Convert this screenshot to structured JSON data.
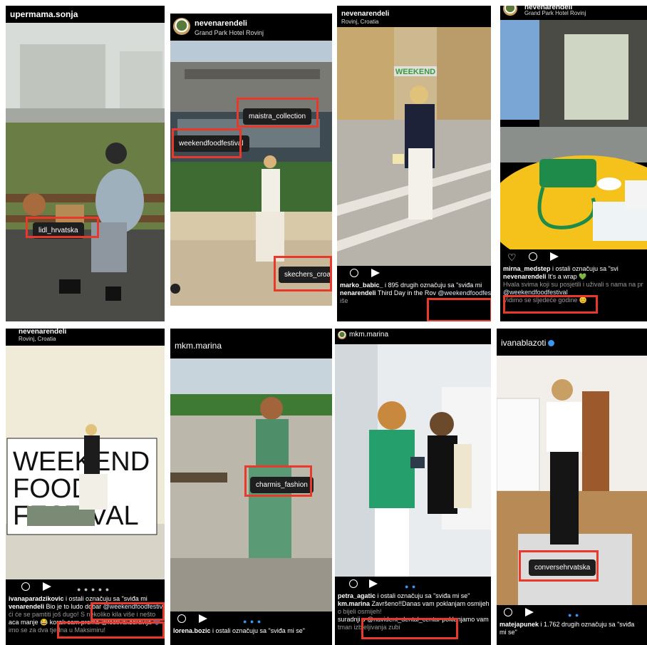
{
  "colors": {
    "highlight": "#e8392b",
    "instagram_black": "#000000",
    "link_blue": "#3897f0"
  },
  "icons": [
    "heart-icon",
    "comment-icon",
    "send-icon",
    "location-icon",
    "verified-icon",
    "carousel-dots-icon"
  ],
  "posts": [
    {
      "username": "upermama.sonja",
      "tag": "lidl_hrvatska"
    },
    {
      "username": "nevenarendeli",
      "location": "Grand Park Hotel Rovinj",
      "tags": [
        "maistra_collection",
        "weekendfoodfestival",
        "skechers_croatia"
      ]
    },
    {
      "username": "nevenarendeli",
      "location": "Rovinj, Croatia",
      "likes_user": "marko_babic_",
      "likes_text": " i 895 drugih označuju sa \"sviđa mi",
      "caption_user": "nenarendeli",
      "caption": "Third Day in the Rov",
      "caption_tag": "@weekendfoodfestiv",
      "caption_more": "iše"
    },
    {
      "username": "nevenarendeli",
      "location": "Grand Park Hotel Rovinj",
      "likes_user": "mirna_medstep",
      "likes_text": " i ostali označuju sa \"svi",
      "caption_user": "nevenarendeli",
      "caption": " It's a wrap 💚",
      "caption2": "Hvala svima koji su posjetili i uživali s nama na pr",
      "caption_tag": "@weekendfoodfestival",
      "caption3": "Vidimo se sljedeće godine 😊"
    },
    {
      "username": "nevenarendeli",
      "location": "Rovinj, Croatia",
      "likes_user": "ivanaparadzikovic",
      "likes_text": " i ostali označuju sa \"sviđa mi",
      "caption_user": "venarendeli",
      "caption": " Bio je to ludo dobar ",
      "caption_tag": "@weekendfoodfestiva",
      "line2": "ći će se pamtiti još dugo! S nekoliko kila više i nešto",
      "line3_a": "aca manje 😂 korak ",
      "caption_tag2": "cam prema @festival.zdravlja 💙",
      "line4": "imo se za dva tjedna u Maksimiru!"
    },
    {
      "username": "mkm.marina",
      "tag": "charmis_fashion",
      "likes_user": "lorena.bozic",
      "likes_text": " i ostali označuju sa \"sviđa mi se\""
    },
    {
      "username": "mkm.marina",
      "likes_user": "petra_agatic",
      "likes_text": " i ostali označuju sa \"sviđa mi se\"",
      "caption_user": "km.marina",
      "caption": " Završeno!!Danas vam poklanjam osmijeh 😊",
      "line2": "o bijeli osmijeh!",
      "line3_a": "suradnji s ",
      "caption_tag": "@navident_dental_centar",
      "line3_b": " poklanjamo vam",
      "line4": "tman izbjeljivanja zubi"
    },
    {
      "username": "ivanablazoti",
      "tag": "conversehrvatska",
      "likes_user": "matejapunek",
      "likes_text": " i 1.762 drugih označuju sa \"sviđa",
      "likes_line2": "mi se\""
    }
  ]
}
